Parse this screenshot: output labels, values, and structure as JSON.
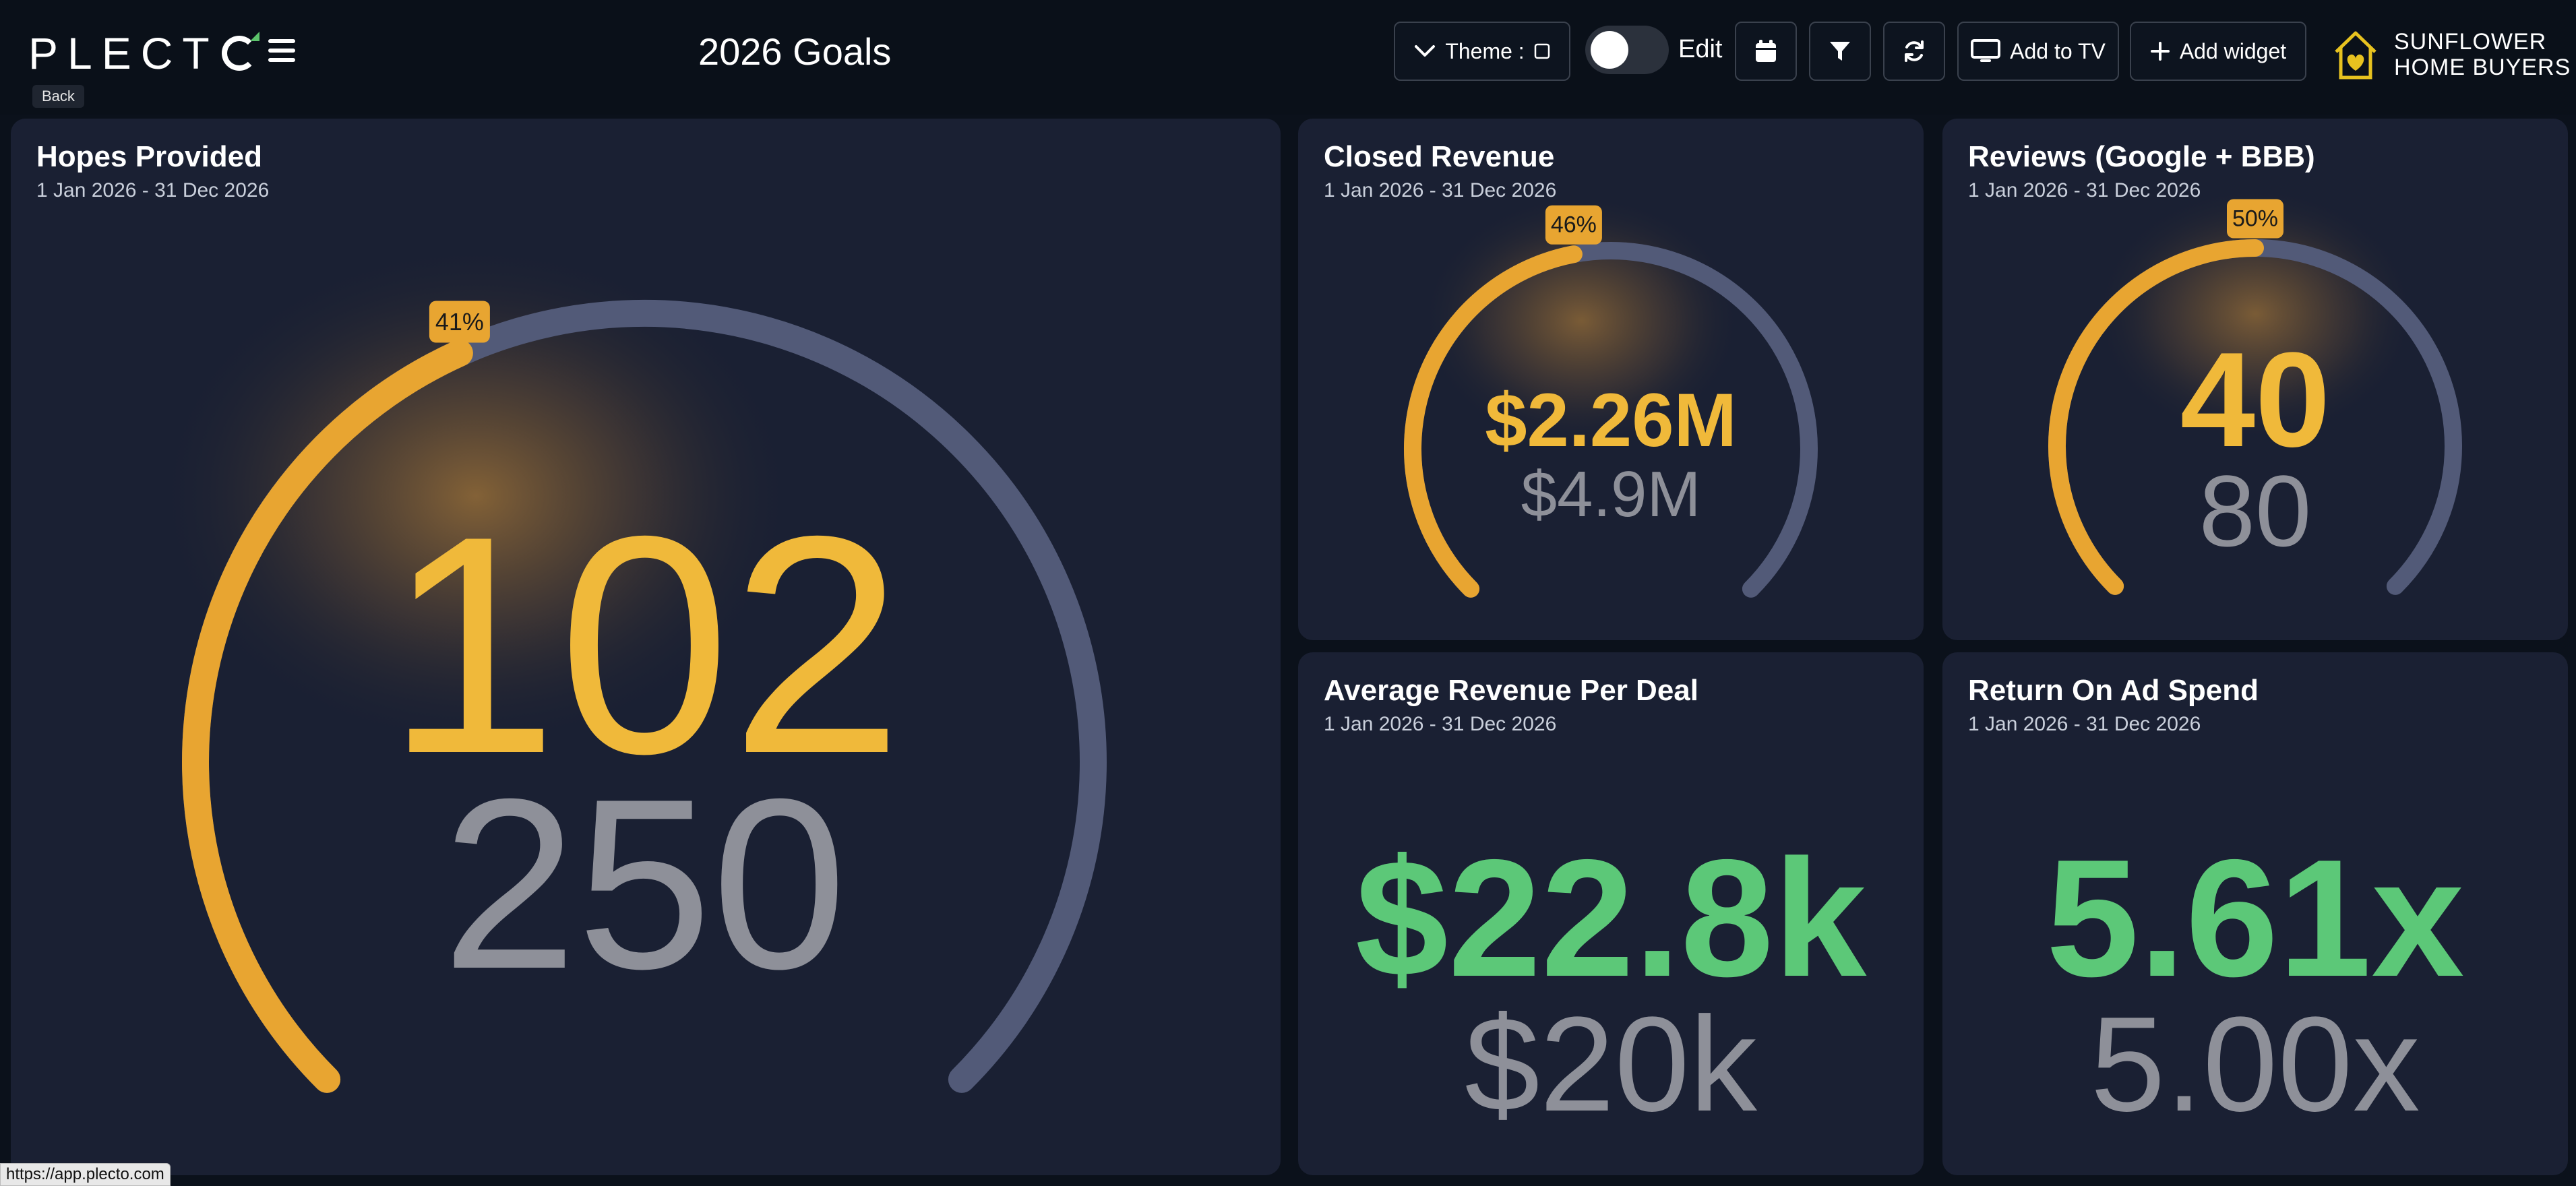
{
  "app": {
    "logo_text": "PLECT",
    "back_label": "Back",
    "dashboard_title": "2026 Goals",
    "status_url": "https://app.plecto.com"
  },
  "toolbar": {
    "theme_label": "Theme :",
    "edit_label": "Edit",
    "edit_toggle_on": false,
    "add_to_tv_label": "Add to TV",
    "add_widget_label": "Add widget"
  },
  "brand": {
    "line1": "SUNFLOWER",
    "line2": "HOME BUYERS"
  },
  "colors": {
    "accent_gold": "#e8a531",
    "value_gold": "#f0b93a",
    "track": "#525a78",
    "target_gray": "#8e9099",
    "success_green": "#5cc878",
    "card_bg": "#1a2033"
  },
  "widgets": {
    "hopes": {
      "title": "Hopes Provided",
      "date_range": "1 Jan 2026 - 31 Dec 2026",
      "value": "102",
      "target": "250",
      "percent_label": "41%",
      "progress": 0.41
    },
    "closed_revenue": {
      "title": "Closed Revenue",
      "date_range": "1 Jan 2026 - 31 Dec 2026",
      "value": "$2.26M",
      "target": "$4.9M",
      "percent_label": "46%",
      "progress": 0.46
    },
    "reviews": {
      "title": "Reviews (Google + BBB)",
      "date_range": "1 Jan 2026 - 31 Dec 2026",
      "value": "40",
      "target": "80",
      "percent_label": "50%",
      "progress": 0.5
    },
    "avg_revenue": {
      "title": "Average Revenue Per Deal",
      "date_range": "1 Jan 2026 - 31 Dec 2026",
      "value": "$22.8k",
      "target": "$20k"
    },
    "roas": {
      "title": "Return On Ad Spend",
      "date_range": "1 Jan 2026 - 31 Dec 2026",
      "value": "5.61x",
      "target": "5.00x"
    }
  }
}
